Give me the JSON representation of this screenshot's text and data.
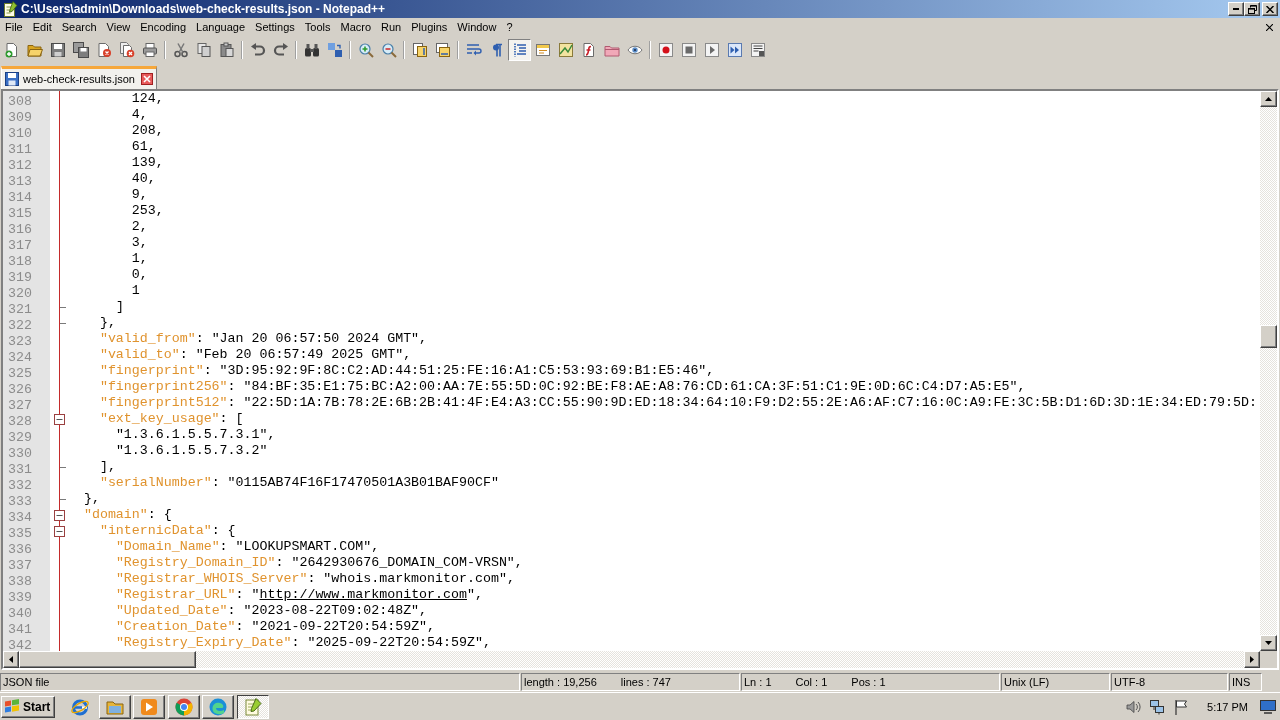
{
  "window": {
    "title": "C:\\Users\\admin\\Downloads\\web-check-results.json - Notepad++"
  },
  "menu": [
    "File",
    "Edit",
    "Search",
    "View",
    "Encoding",
    "Language",
    "Settings",
    "Tools",
    "Macro",
    "Run",
    "Plugins",
    "Window",
    "?"
  ],
  "toolbar": {
    "groups": [
      [
        {
          "on": false
        },
        {
          "on": false
        },
        {
          "on": false
        },
        {
          "on": false
        },
        {
          "on": false
        },
        {
          "on": false
        },
        {
          "on": false
        }
      ],
      [
        {
          "on": false
        },
        {
          "on": false
        },
        {
          "on": false
        }
      ],
      [
        {
          "on": false
        },
        {
          "on": false
        }
      ],
      [
        {
          "on": false
        },
        {
          "on": false
        }
      ],
      [
        {
          "on": false
        },
        {
          "on": false
        }
      ],
      [
        {
          "on": false
        },
        {
          "on": false
        }
      ],
      [
        {
          "on": false
        },
        {
          "on": false
        },
        {
          "on": true
        },
        {
          "on": false
        },
        {
          "on": false
        },
        {
          "on": false
        },
        {
          "on": false
        },
        {
          "on": false
        }
      ],
      [
        {
          "on": false
        },
        {
          "on": false
        },
        {
          "on": false
        },
        {
          "on": false
        },
        {
          "on": false
        }
      ]
    ]
  },
  "tabs": [
    {
      "label": "web-check-results.json",
      "selected": true
    }
  ],
  "editor": {
    "lines": [
      {
        "children": [
          {
            "children": [
              {
                "children": [
                  {
                    "children": [
                      {
                        "number": "308",
                        "tokens": [
                          {
                            "kind": "text",
                            "text": "124,"
                          }
                        ]
                      },
                      {
                        "number": "309",
                        "tokens": [
                          {
                            "kind": "text",
                            "text": "4,"
                          }
                        ]
                      },
                      {
                        "number": "310",
                        "tokens": [
                          {
                            "kind": "text",
                            "text": "208,"
                          }
                        ]
                      },
                      {
                        "number": "311",
                        "tokens": [
                          {
                            "kind": "text",
                            "text": "61,"
                          }
                        ]
                      },
                      {
                        "number": "312",
                        "tokens": [
                          {
                            "kind": "text",
                            "text": "139,"
                          }
                        ]
                      },
                      {
                        "number": "313",
                        "tokens": [
                          {
                            "kind": "text",
                            "text": "40,"
                          }
                        ]
                      },
                      {
                        "number": "314",
                        "tokens": [
                          {
                            "kind": "text",
                            "text": "9,"
                          }
                        ]
                      },
                      {
                        "number": "315",
                        "tokens": [
                          {
                            "kind": "text",
                            "text": "253,"
                          }
                        ]
                      },
                      {
                        "number": "316",
                        "tokens": [
                          {
                            "kind": "text",
                            "text": "2,"
                          }
                        ]
                      },
                      {
                        "number": "317",
                        "tokens": [
                          {
                            "kind": "text",
                            "text": "3,"
                          }
                        ]
                      },
                      {
                        "number": "318",
                        "tokens": [
                          {
                            "kind": "text",
                            "text": "1,"
                          }
                        ]
                      },
                      {
                        "number": "319",
                        "tokens": [
                          {
                            "kind": "text",
                            "text": "0,"
                          }
                        ]
                      },
                      {
                        "number": "320",
                        "tokens": [
                          {
                            "kind": "text",
                            "text": "1"
                          }
                        ]
                      }
                    ]
                  },
                  {
                    "number": "321",
                    "kind": "closer",
                    "tokens": [
                      {
                        "kind": "text",
                        "text": "]"
                      }
                    ]
                  }
                ]
              },
              {
                "number": "322",
                "kind": "closer",
                "tokens": [
                  {
                    "kind": "text",
                    "text": "},"
                  }
                ]
              },
              {
                "number": "323",
                "tokens": [
                  {
                    "kind": "key",
                    "text": "\"valid_from\""
                  },
                  {
                    "kind": "text",
                    "text": ": \"Jan 20 06:57:50 2024 GMT\","
                  }
                ]
              },
              {
                "number": "324",
                "tokens": [
                  {
                    "kind": "key",
                    "text": "\"valid_to\""
                  },
                  {
                    "kind": "text",
                    "text": ": \"Feb 20 06:57:49 2025 GMT\","
                  }
                ]
              },
              {
                "number": "325",
                "tokens": [
                  {
                    "kind": "key",
                    "text": "\"fingerprint\""
                  },
                  {
                    "kind": "text",
                    "text": ": \"3D:95:92:9F:8C:C2:AD:44:51:25:FE:16:A1:C5:53:93:69:B1:E5:46\","
                  }
                ]
              },
              {
                "number": "326",
                "tokens": [
                  {
                    "kind": "key",
                    "text": "\"fingerprint256\""
                  },
                  {
                    "kind": "text",
                    "text": ": \"84:BF:35:E1:75:BC:A2:00:AA:7E:55:5D:0C:92:BE:F8:AE:A8:76:CD:61:CA:3F:51:C1:9E:0D:6C:C4:D7:A5:E5\","
                  }
                ]
              },
              {
                "number": "327",
                "tokens": [
                  {
                    "kind": "key",
                    "text": "\"fingerprint512\""
                  },
                  {
                    "kind": "text",
                    "text": ": \"22:5D:1A:7B:78:2E:6B:2B:41:4F:E4:A3:CC:55:90:9D:ED:18:34:64:10:F9:D2:55:2E:A6:AF:C7:16:0C:A9:FE:3C:5B:D1:6D:3D:1E:34:ED:79:5D:"
                  }
                ]
              },
              {
                "number": "328",
                "kind": "opener",
                "tokens": [
                  {
                    "kind": "key",
                    "text": "\"ext_key_usage\""
                  },
                  {
                    "kind": "text",
                    "text": ": ["
                  }
                ],
                "children": [
                  {
                    "number": "329",
                    "tokens": [
                      {
                        "kind": "text",
                        "text": "\"1.3.6.1.5.5.7.3.1\","
                      }
                    ]
                  },
                  {
                    "number": "330",
                    "tokens": [
                      {
                        "kind": "text",
                        "text": "\"1.3.6.1.5.5.7.3.2\""
                      }
                    ]
                  }
                ]
              },
              {
                "number": "331",
                "kind": "closer",
                "tokens": [
                  {
                    "kind": "text",
                    "text": "],"
                  }
                ]
              },
              {
                "number": "332",
                "tokens": [
                  {
                    "kind": "key",
                    "text": "\"serialNumber\""
                  },
                  {
                    "kind": "text",
                    "text": ": \"0115AB74F16F17470501A3B01BAF90CF\""
                  }
                ]
              }
            ]
          },
          {
            "number": "333",
            "kind": "closer",
            "tokens": [
              {
                "kind": "text",
                "text": "},"
              }
            ]
          },
          {
            "number": "334",
            "kind": "opener",
            "tokens": [
              {
                "kind": "key",
                "text": "\"domain\""
              },
              {
                "kind": "text",
                "text": ": {"
              }
            ],
            "children": [
              {
                "number": "335",
                "kind": "opener",
                "tokens": [
                  {
                    "kind": "key",
                    "text": "\"internicData\""
                  },
                  {
                    "kind": "text",
                    "text": ": {"
                  }
                ],
                "children": [
                  {
                    "number": "336",
                    "tokens": [
                      {
                        "kind": "key",
                        "text": "\"Domain_Name\""
                      },
                      {
                        "kind": "text",
                        "text": ": \"LOOKUPSMART.COM\","
                      }
                    ]
                  },
                  {
                    "number": "337",
                    "tokens": [
                      {
                        "kind": "key",
                        "text": "\"Registry_Domain_ID\""
                      },
                      {
                        "kind": "text",
                        "text": ": \"2642930676_DOMAIN_COM-VRSN\","
                      }
                    ]
                  },
                  {
                    "number": "338",
                    "tokens": [
                      {
                        "kind": "key",
                        "text": "\"Registrar_WHOIS_Server\""
                      },
                      {
                        "kind": "text",
                        "text": ": \"whois.markmonitor.com\","
                      }
                    ]
                  },
                  {
                    "number": "339",
                    "tokens": [
                      {
                        "kind": "key",
                        "text": "\"Registrar_URL\""
                      },
                      {
                        "kind": "text",
                        "text": ": \""
                      },
                      {
                        "kind": "link",
                        "text": "http://www.markmonitor.com"
                      },
                      {
                        "kind": "text",
                        "text": "\","
                      }
                    ]
                  },
                  {
                    "number": "340",
                    "tokens": [
                      {
                        "kind": "key",
                        "text": "\"Updated_Date\""
                      },
                      {
                        "kind": "text",
                        "text": ": \"2023-08-22T09:02:48Z\","
                      }
                    ]
                  },
                  {
                    "number": "341",
                    "tokens": [
                      {
                        "kind": "key",
                        "text": "\"Creation_Date\""
                      },
                      {
                        "kind": "text",
                        "text": ": \"2021-09-22T20:54:59Z\","
                      }
                    ]
                  },
                  {
                    "number": "342",
                    "tokens": [
                      {
                        "kind": "key",
                        "text": "\"Registry_Expiry_Date\""
                      },
                      {
                        "kind": "text",
                        "text": ": \"2025-09-22T20:54:59Z\","
                      }
                    ]
                  }
                ]
              }
            ]
          }
        ]
      }
    ]
  },
  "status_bar": {
    "file_type": "JSON file",
    "document": [
      "length : 19,256",
      "lines : 747"
    ],
    "cursor": [
      "Ln : 1",
      "Col : 1",
      "Pos : 1"
    ],
    "eol": "Unix (LF)",
    "encoding": "UTF-8",
    "mode": "INS"
  },
  "taskbar": {
    "start": "Start",
    "apps": [
      {
        "kind": "launcher",
        "selected": false
      },
      {
        "kind": "button",
        "selected": false
      },
      {
        "kind": "button",
        "selected": false
      },
      {
        "kind": "button",
        "selected": false
      },
      {
        "kind": "button",
        "selected": false
      },
      {
        "kind": "button",
        "selected": true
      }
    ],
    "clock": "5:17 PM"
  }
}
